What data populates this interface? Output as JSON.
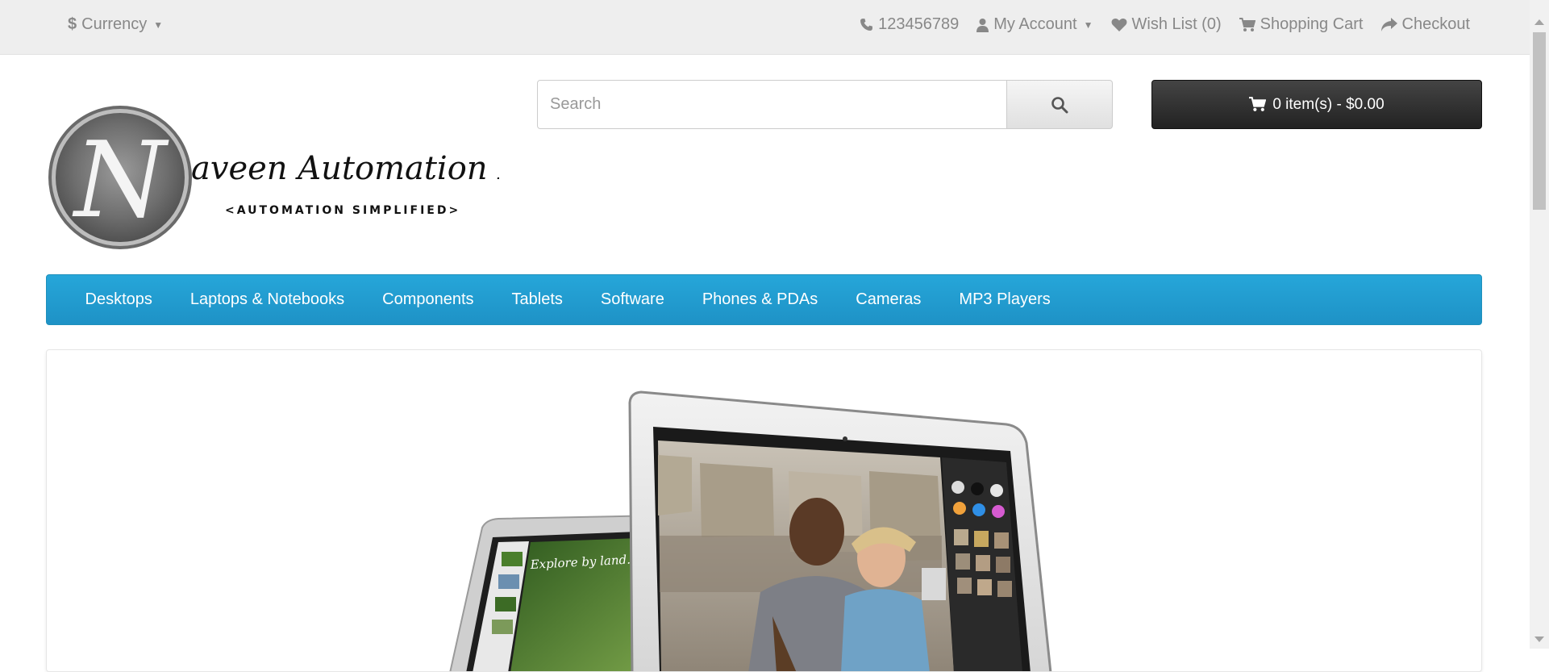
{
  "topbar": {
    "currency_label": "Currency",
    "currency_symbol": "$",
    "phone": "123456789",
    "my_account": "My Account",
    "wish_list": "Wish List (0)",
    "shopping_cart": "Shopping Cart",
    "checkout": "Checkout"
  },
  "logo": {
    "letter": "N",
    "name": "aveen Automation Labs",
    "tagline": "<AUTOMATION SIMPLIFIED>"
  },
  "search": {
    "placeholder": "Search",
    "value": "",
    "icon": "search-icon"
  },
  "cart": {
    "label": "0 item(s) - $0.00",
    "icon": "cart-icon"
  },
  "menu": {
    "items": [
      {
        "label": "Desktops"
      },
      {
        "label": "Laptops & Notebooks"
      },
      {
        "label": "Components"
      },
      {
        "label": "Tablets"
      },
      {
        "label": "Software"
      },
      {
        "label": "Phones & PDAs"
      },
      {
        "label": "Cameras"
      },
      {
        "label": "MP3 Players"
      }
    ]
  },
  "slideshow": {
    "ipad_caption": "Explore by land."
  },
  "colors": {
    "topbar_bg": "#eeeeee",
    "menu_bg": "#229ac8",
    "cart_bg": "#303030",
    "link": "#888888"
  }
}
